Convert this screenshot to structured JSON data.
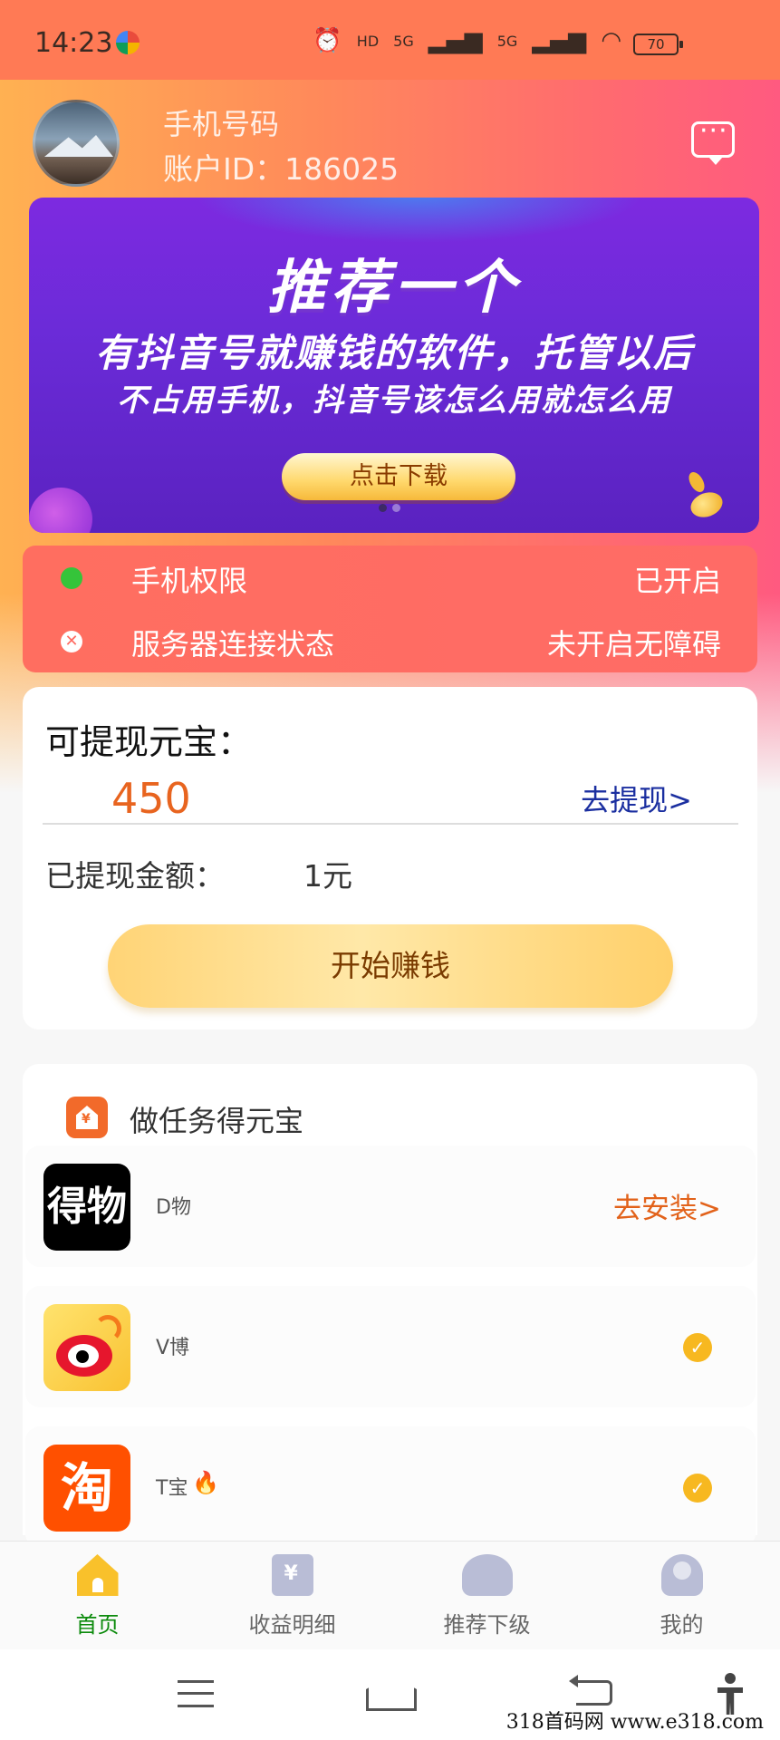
{
  "status_bar": {
    "time": "14:23",
    "indicators": [
      "HD",
      "5G",
      "5G"
    ],
    "battery": "70"
  },
  "header": {
    "phone_label": "手机号码",
    "account_id": "账户ID：186025"
  },
  "banner": {
    "title": "推荐一个",
    "line1": "有抖音号就赚钱的软件，托管以后",
    "line2": "不占用手机，抖音号该怎么用就怎么用",
    "button": "点击下载",
    "total_slides": 2,
    "active_slide": 1
  },
  "status_panel": [
    {
      "label": "手机权限",
      "value": "已开启",
      "icon": "green-dot-icon"
    },
    {
      "label": "服务器连接状态",
      "value": "未开启无障碍",
      "icon": "close-circle-icon"
    }
  ],
  "wallet": {
    "title": "可提现元宝：",
    "amount": "450",
    "withdraw_link": "去提现>",
    "withdrawn_label": "已提现金额：",
    "withdrawn_value": "1元",
    "start_button": "开始赚钱"
  },
  "tasks": {
    "title": "做任务得元宝",
    "items": [
      {
        "icon_text": "得物",
        "name": "D物",
        "action": "去安装>",
        "state": "install"
      },
      {
        "icon_text": "",
        "name": "V博",
        "action": "",
        "state": "done"
      },
      {
        "icon_text": "淘",
        "name": "T宝",
        "action": "",
        "state": "done",
        "hot": "🔥"
      }
    ]
  },
  "bottom_nav": [
    {
      "label": "首页",
      "active": true
    },
    {
      "label": "收益明细",
      "active": false
    },
    {
      "label": "推荐下级",
      "active": false
    },
    {
      "label": "我的",
      "active": false
    }
  ],
  "watermark": "318首码网  www.e318.com",
  "colors": {
    "accent_orange": "#e8641f",
    "link_blue": "#1b2fa0",
    "active_green": "#0b8a0b",
    "banner_purple": "#6b2bd8"
  }
}
